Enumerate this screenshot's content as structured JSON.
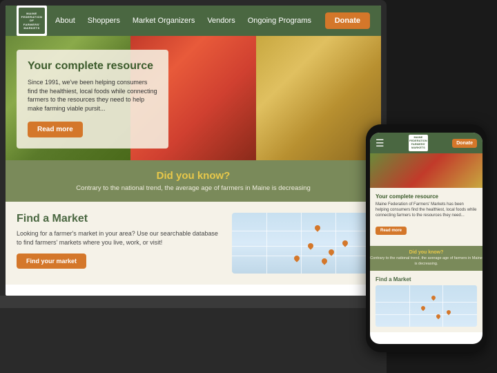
{
  "site": {
    "logo_lines": [
      "MAINE",
      "FEDERATION OF",
      "FARMERS'",
      "MARKETS"
    ],
    "logo_short": "MAINE\nFEDERATION\nFARMERS'\nMARKETS"
  },
  "nav": {
    "about": "About",
    "shoppers": "Shoppers",
    "market_organizers": "Market Organizers",
    "vendors": "Vendors",
    "ongoing_programs": "Ongoing Programs",
    "donate": "Donate"
  },
  "hero": {
    "title": "Your complete resource",
    "description": "Since 1991, we've been helping consumers find the healthiest, local foods while connecting farmers to the resources they need to help make farming viable pursit...",
    "read_more": "Read more"
  },
  "did_you_know": {
    "title": "Did you know?",
    "text": "Contrary to the national trend, the average age of farmers in Maine is decreasing"
  },
  "find_market": {
    "title": "Find a Market",
    "description": "Looking for a farmer's market in your area? Use our searchable database to find farmers' markets where you live, work, or visit!",
    "button": "Find your market"
  },
  "phone": {
    "donate": "Donate",
    "hero_title": "Your complete resource",
    "hero_desc": "Maine Federation of Farmers' Markets has been helping consumers find the healthiest, local foods while connecting farmers to the resources they need...",
    "read_more": "Read more",
    "dyk_title": "Did you know?",
    "dyk_text": "Contrary to the national trend, the average age of farmers in Maine is decreasing.",
    "find_market": "Find a Market"
  },
  "colors": {
    "green": "#4a6741",
    "orange": "#d4772a",
    "gold": "#e8c84a",
    "olive": "#7a8a5a",
    "cream": "#f5f2e8"
  }
}
